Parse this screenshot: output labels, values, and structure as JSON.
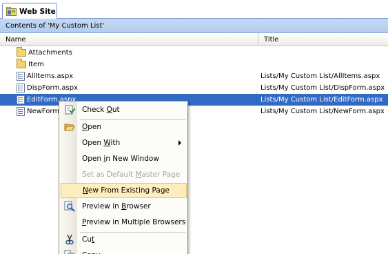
{
  "tab": {
    "label": "Web Site"
  },
  "contents_header": "Contents of 'My Custom List'",
  "columns": {
    "name": "Name",
    "title": "Title"
  },
  "rows": [
    {
      "name": "Attachments",
      "title": "",
      "type": "folder"
    },
    {
      "name": "Item",
      "title": "",
      "type": "folder"
    },
    {
      "name": "AllItems.aspx",
      "title": "Lists/My Custom List/AllItems.aspx",
      "type": "page"
    },
    {
      "name": "DispForm.aspx",
      "title": "Lists/My Custom List/DispForm.aspx",
      "type": "page"
    },
    {
      "name": "EditForm.aspx",
      "title": "Lists/My Custom List/EditForm.aspx",
      "type": "page",
      "selected": true
    },
    {
      "name": "NewForm.aspx",
      "title": "Lists/My Custom List/NewForm.aspx",
      "type": "page"
    }
  ],
  "context_menu": {
    "check_out": {
      "pre": "Check ",
      "acc": "O",
      "post": "ut"
    },
    "open": {
      "pre": "",
      "acc": "O",
      "post": "pen"
    },
    "open_with": {
      "pre": "Open ",
      "acc": "W",
      "post": "ith"
    },
    "open_new_window": {
      "pre": "Open ",
      "acc": "i",
      "post": "n New Window"
    },
    "set_default": {
      "pre": "Set as Default ",
      "acc": "M",
      "post": "aster Page"
    },
    "new_from_existing": {
      "pre": "",
      "acc": "N",
      "post": "ew From Existing Page"
    },
    "preview_browser": {
      "pre": "Preview in ",
      "acc": "B",
      "post": "rowser"
    },
    "preview_multiple": {
      "pre": "",
      "acc": "P",
      "post": "review in Multiple Browsers"
    },
    "cut": {
      "pre": "Cu",
      "acc": "t",
      "post": ""
    },
    "copy": {
      "pre": "",
      "acc": "C",
      "post": "opy"
    }
  },
  "colors": {
    "selection": "#316ac5",
    "menu_hover": "#ffeebd",
    "header_blue": "#c4d9f4"
  }
}
